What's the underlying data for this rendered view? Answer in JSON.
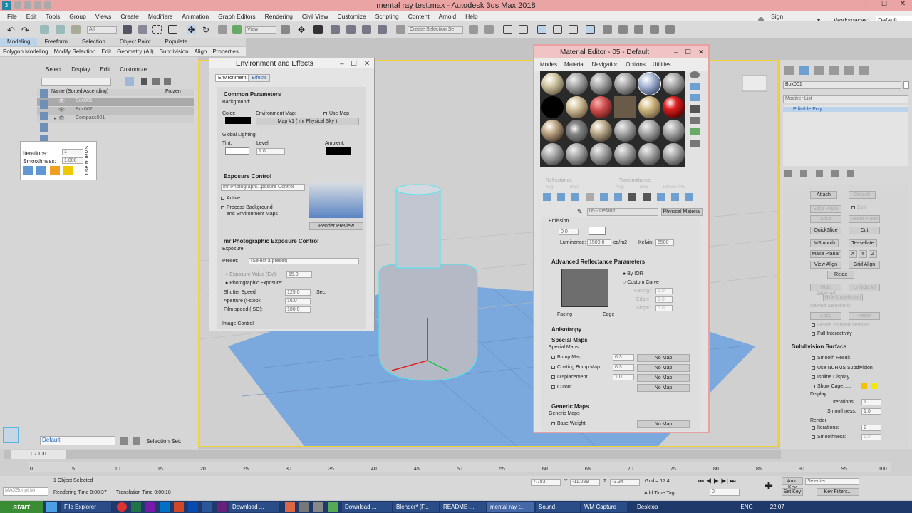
{
  "window": {
    "title": "mental ray test.max - Autodesk 3ds Max 2018"
  },
  "menus": [
    "File",
    "Edit",
    "Tools",
    "Group",
    "Views",
    "Create",
    "Modifiers",
    "Animation",
    "Graph Editors",
    "Rendering",
    "Civil View",
    "Customize",
    "Scripting",
    "Content",
    "Arnold",
    "Help"
  ],
  "account": {
    "signin": "Sign In",
    "workspaces_label": "Workspaces:",
    "workspace": "Default"
  },
  "toolbar": {
    "filter": "All",
    "viewmode": "View",
    "selset": "Create Selection Se"
  },
  "ribbon": {
    "tabs": [
      "Modeling",
      "Freeform",
      "Selection",
      "Object Paint",
      "Populate"
    ],
    "subtabs": [
      "Polygon Modeling",
      "Modify Selection",
      "Edit",
      "Geometry (All)",
      "Subdivision",
      "Align",
      "Properties"
    ]
  },
  "scene_explorer": {
    "menu": [
      "Select",
      "Display",
      "Edit",
      "Customize"
    ],
    "col_name": "Name (Sorted Ascending)",
    "col_frozen": "Frozen",
    "rows": [
      "Box001",
      "Box002",
      "Compass001"
    ],
    "layer": "Default",
    "selection_set": "Selection Set:"
  },
  "nurms": {
    "iter_label": "Iterations:",
    "iter_val": "1",
    "smooth_label": "Smoothness:",
    "smooth_val": "1.000",
    "use_nurms": "Use NURMS"
  },
  "env": {
    "title": "Environment and Effects",
    "tabs": [
      "Environment",
      "Effects"
    ],
    "common": "Common Parameters",
    "background": "Background:",
    "color": "Color:",
    "envmap": "Environment Map:",
    "usemap": "Use Map",
    "mapname": "Map #1  ( mr Physical Sky )",
    "global_lighting": "Global Lighting:",
    "tint": "Tint:",
    "level": "Level:",
    "level_val": "1.0",
    "ambient": "Ambient:",
    "exposure_control": "Exposure Control",
    "exposure_type": "mr Photographi...posure Control",
    "active": "Active",
    "process_bg": "Process Background",
    "process_bg2": "and Environment Maps",
    "render_preview": "Render Preview",
    "mr_exposure": "mr Photographic Exposure Control",
    "exposure": "Exposure",
    "preset": "Preset:",
    "preset_val": "(Select a preset)",
    "ev": "Exposure Value (EV):",
    "ev_val": "15.0",
    "photo_exp": "Photographic Exposure:",
    "shutter": "Shutter Speed:",
    "shutter_val": "125.0",
    "sec": "Sec.",
    "aperture": "Aperture (f-stop):",
    "aperture_val": "16.0",
    "film": "Film speed (ISO):",
    "film_val": "100.0",
    "image_control": "Image Control"
  },
  "mat": {
    "title": "Material Editor - 05 - Default",
    "menu": [
      "Modes",
      "Material",
      "Navigation",
      "Options",
      "Utilities"
    ],
    "reflectance": "Reflectance",
    "transmittance": "Transmittance",
    "avg1": "Avg:",
    "max1": "Max:",
    "avg2": "Avg:",
    "max2": "Max:",
    "diffuse": "Diffuse: 0%",
    "matname": "05 - Default",
    "mattype": "Physical Material",
    "emission": "Emission",
    "em_val": "0.0",
    "luminance": "Luminance:",
    "lum_val": "1500.0",
    "lum_unit": "cd/m2",
    "kelvin": "Kelvin:",
    "kelvin_val": "6500",
    "adv_refl": "Advanced Reflectance Parameters",
    "by_ior": "By IOR",
    "custom_curve": "Custom Curve",
    "facing": "Facing:",
    "facing_val": "1.0",
    "edge": "Edge:",
    "edge_val": "1.0",
    "slope": "Slope:",
    "slope_val": "5.0",
    "facing_lbl": "Facing",
    "edge_lbl": "Edge",
    "anisotropy": "Anisotropy",
    "special": "Special Maps",
    "special_sub": "Special Maps",
    "bump": "Bump Map",
    "bump_val": "0.3",
    "coating": "Coating Bump Map:",
    "coating_val": "0.3",
    "displacement": "Displacement",
    "disp_val": "1.0",
    "cutout": "Cutout",
    "nomap": "No Map",
    "generic": "Generic Maps",
    "generic_sub": "Generic Maps",
    "base_weight": "Base Weight"
  },
  "cmd": {
    "object_name": "Box001",
    "modifier_list": "Modifier List",
    "modifier": "Editable Poly",
    "attach": "Attach",
    "detach": "Detach",
    "slice_plane": "Slice Plane",
    "split": "Split",
    "slice": "Slice",
    "reset_plane": "Reset Plane",
    "quickslice": "QuickSlice",
    "cut": "Cut",
    "msmooth": "MSmooth",
    "tessellate": "Tessellate",
    "make_planar": "Make Planar",
    "x": "X",
    "y": "Y",
    "z": "Z",
    "view_align": "View Align",
    "grid_align": "Grid Align",
    "relax": "Relax",
    "hide_sel": "Hide Selected",
    "unhide": "Unhide All",
    "hide_unsel": "Hide Unselected",
    "named_sel": "Named Selections:",
    "copy": "Copy",
    "paste": "Paste",
    "delete_iso": "Delete Isolated Vertices",
    "full_inter": "Full Interactivity",
    "subdiv": "Subdivision Surface",
    "smooth_result": "Smooth Result",
    "use_nurms_sub": "Use NURMS Subdivision",
    "isoline": "Isoline Display",
    "show_cage": "Show Cage......",
    "display": "Display",
    "iterations": "Iterations:",
    "iter_val": "1",
    "smoothness": "Smoothness:",
    "smooth_val": "1.0",
    "render": "Render",
    "r_iter_val": "2",
    "r_smooth_val": "1.0"
  },
  "timeline": {
    "frame": "0 / 100",
    "ticks": [
      "0",
      "5",
      "10",
      "15",
      "20",
      "25",
      "30",
      "35",
      "40",
      "45",
      "50",
      "55",
      "60",
      "65",
      "70",
      "75",
      "80",
      "85",
      "90",
      "95",
      "100"
    ]
  },
  "status": {
    "maxscript": "MAXScript Mi",
    "selected": "1 Object Selected",
    "render_time": "Rendering Time 0:00:37",
    "trans_time": "Translation Time 0:00:18",
    "x_val": "7.783",
    "y_label": "Y:",
    "y_val": "-11.089",
    "z_label": "Z:",
    "z_val": "-3.34",
    "grid": "Grid = 17.4",
    "add_time_tag": "Add Time Tag",
    "auto_key": "Auto Key",
    "set_key": "Set Key",
    "selected_dd": "Selected",
    "key_filters": "Key Filters...",
    "frame_val": "0"
  },
  "taskbar": {
    "start": "start",
    "tasks": [
      "File Explorer",
      "Download ...",
      "Download ...",
      "Blender* [F...",
      "README-...",
      "mental ray t...",
      "Sound",
      "WM Capture"
    ],
    "desktop": "Desktop",
    "lang": "ENG",
    "clock": "22:07"
  }
}
